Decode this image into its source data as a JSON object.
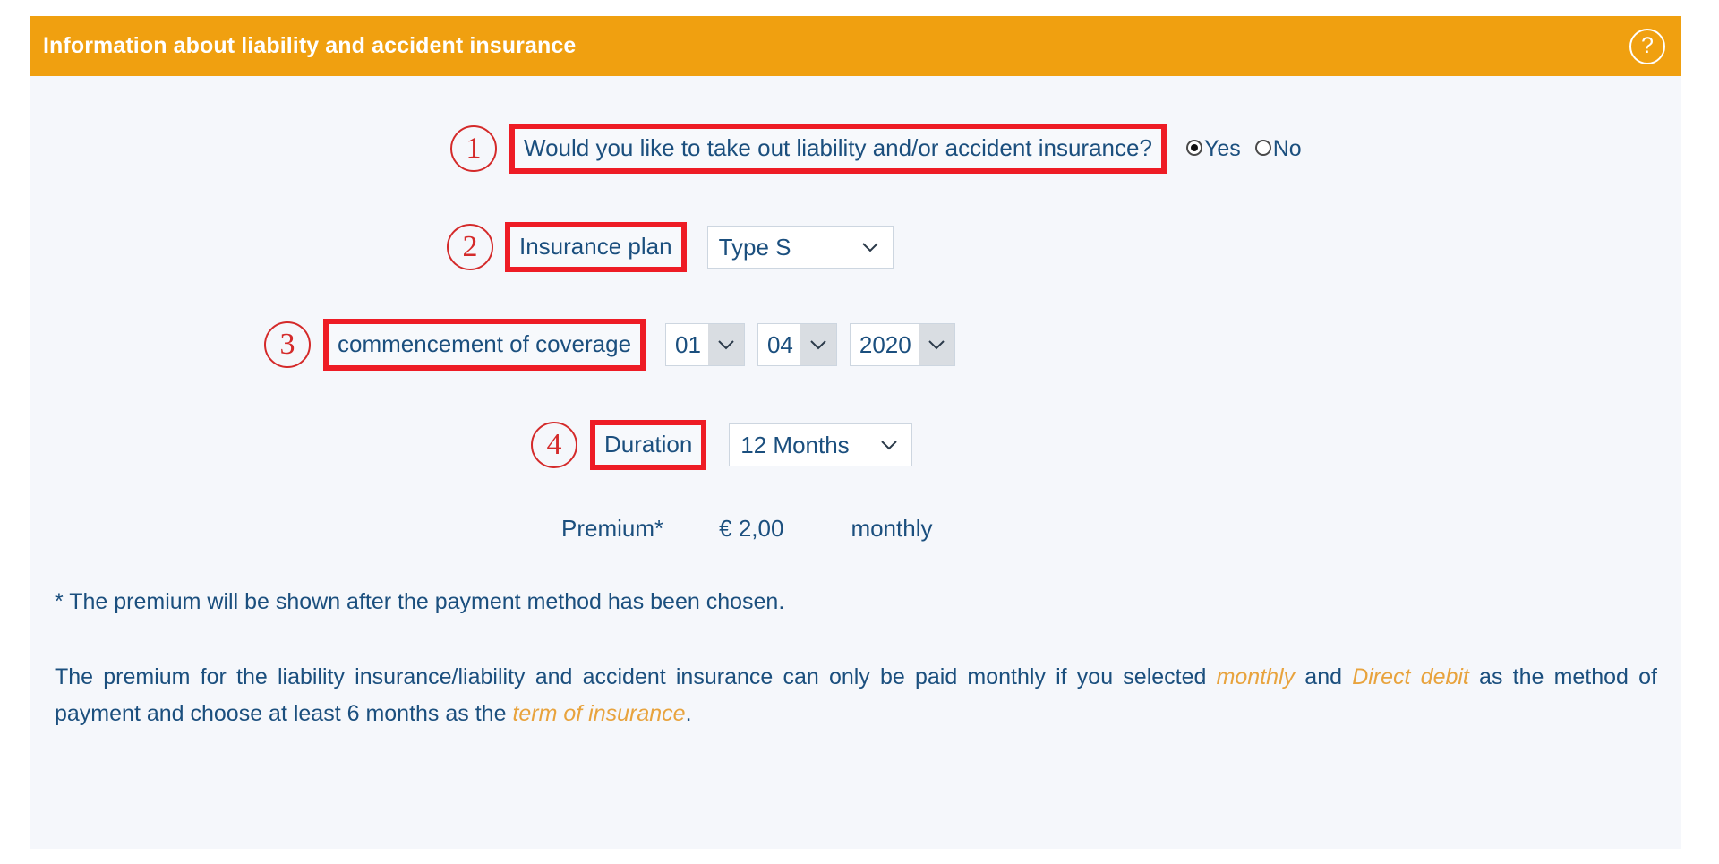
{
  "header": {
    "title": "Information about liability and accident insurance",
    "help_icon": "question-mark-circle-icon",
    "background_color": "#f0a010",
    "title_color": "#ffffff"
  },
  "theme": {
    "panel_background": "#f5f7fb",
    "text_color": "#1b4f7e",
    "annotation_color": "#ee1c25",
    "marker_color": "#d42a2a",
    "highlight_italic_color": "#e8a33d"
  },
  "form": {
    "rows": [
      {
        "marker": "1",
        "label": "Would you like to take out liability and/or accident insurance?",
        "boxed": true
      },
      {
        "marker": "2",
        "label": "Insurance plan",
        "boxed": true
      },
      {
        "marker": "3",
        "label": "commencement of coverage",
        "boxed": true
      },
      {
        "marker": "4",
        "label": "Duration",
        "boxed": true
      }
    ],
    "radio": {
      "yes_label": "Yes",
      "no_label": "No",
      "selected": "Yes"
    },
    "insurance_plan": {
      "value": "Type S",
      "chevron": "chevron-down-icon"
    },
    "commencement": {
      "day": "01",
      "month": "04",
      "year": "2020",
      "chevron": "chevron-down-icon"
    },
    "duration": {
      "value": "12 Months",
      "chevron": "chevron-down-icon"
    },
    "premium": {
      "label": "Premium*",
      "amount": "€ 2,00",
      "interval": "monthly"
    }
  },
  "notes": {
    "footnote": "* The premium will be shown after the payment method has been chosen.",
    "paragraph": {
      "part1": "The premium for the liability insurance/liability and accident insurance can only be paid monthly if you selected ",
      "em1": "monthly",
      "part2": " and ",
      "em2": "Direct debit",
      "part3": " as the method of payment and choose at least 6 months as the ",
      "em3": "term of insurance",
      "part4": "."
    }
  }
}
